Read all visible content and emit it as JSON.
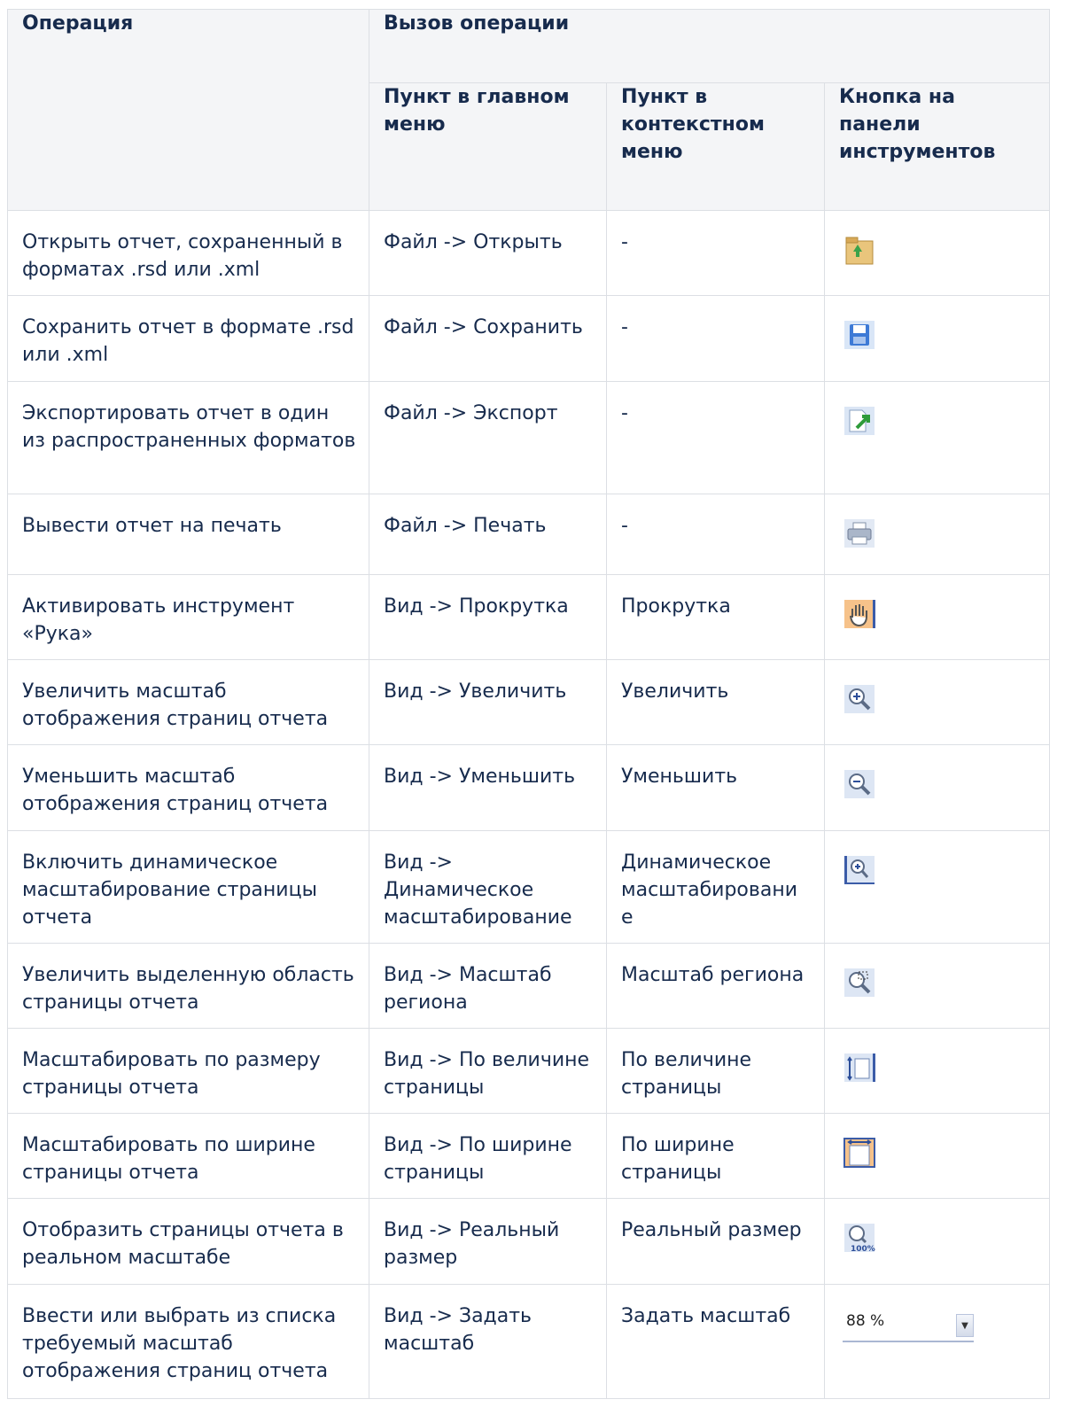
{
  "header": {
    "operation": "Операция",
    "call": "Вызов операции",
    "main_menu": "Пункт в главном меню",
    "context_menu": "Пункт в контекстном меню",
    "toolbar_button": "Кнопка на панели инструментов"
  },
  "rows": [
    {
      "operation": "Открыть отчет, сохраненный в форматах .rsd или .xml",
      "main_menu": "Файл -> Открыть",
      "context_menu": "-",
      "icon": "open-folder-icon"
    },
    {
      "operation": "Сохранить отчет в формате .rsd или .xml",
      "main_menu": "Файл -> Сохранить",
      "context_menu": "-",
      "icon": "save-floppy-icon"
    },
    {
      "operation": "Экспортировать отчет в один из распространенных форматов",
      "main_menu": "Файл -> Экспорт",
      "context_menu": "-",
      "icon": "export-icon"
    },
    {
      "operation": "Вывести отчет на печать",
      "main_menu": "Файл -> Печать",
      "context_menu": "-",
      "icon": "printer-icon"
    },
    {
      "operation": "Активировать инструмент «Рука»",
      "main_menu": "Вид -> Прокрутка",
      "context_menu": "Прокрутка",
      "icon": "hand-icon"
    },
    {
      "operation": "Увеличить масштаб отображения страниц отчета",
      "main_menu": "Вид -> Увеличить",
      "context_menu": "Увеличить",
      "icon": "zoom-in-icon"
    },
    {
      "operation": "Уменьшить масштаб отображения страниц отчета",
      "main_menu": "Вид -> Уменьшить",
      "context_menu": "Уменьшить",
      "icon": "zoom-out-icon"
    },
    {
      "operation": "Включить динамическое масштабирование страницы отчета",
      "main_menu": "Вид -> Динамическое масштабирование",
      "context_menu": "Динамическое масштабировани е",
      "icon": "dynamic-zoom-icon"
    },
    {
      "operation": "Увеличить выделенную область страницы отчета",
      "main_menu": "Вид -> Масштаб региона",
      "context_menu": "Масштаб региона",
      "icon": "zoom-region-icon"
    },
    {
      "operation": "Масштабировать по размеру страницы отчета",
      "main_menu": "Вид -> По величине страницы",
      "context_menu": "По величине страницы",
      "icon": "fit-page-icon"
    },
    {
      "operation": "Масштабировать по ширине страницы отчета",
      "main_menu": "Вид -> По ширине страницы",
      "context_menu": "По ширине страницы",
      "icon": "fit-width-icon"
    },
    {
      "operation": "Отобразить страницы отчета в реальном масштабе",
      "main_menu": "Вид -> Реальный размер",
      "context_menu": "Реальный размер",
      "icon": "actual-size-icon"
    },
    {
      "operation": "Ввести или выбрать из списка требуемый масштаб отображения страниц отчета",
      "main_menu": "Вид -> Задать масштаб",
      "context_menu": "Задать масштаб",
      "icon": "zoom-combo",
      "combo_value": "88 %"
    }
  ]
}
